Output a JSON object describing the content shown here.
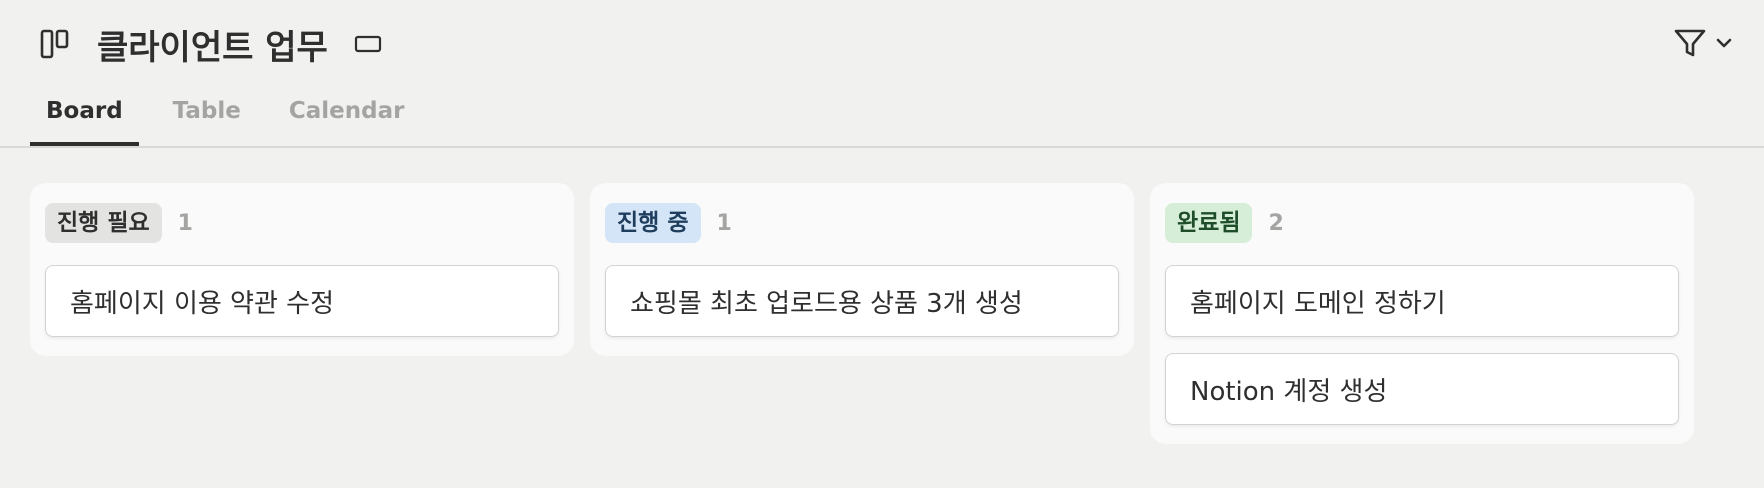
{
  "header": {
    "title": "클라이언트 업무"
  },
  "tabs": [
    {
      "label": "Board",
      "active": true
    },
    {
      "label": "Table",
      "active": false
    },
    {
      "label": "Calendar",
      "active": false
    }
  ],
  "board": {
    "columns": [
      {
        "label": "진행 필요",
        "count": "1",
        "color": "#e3e3e1",
        "cards": [
          "홈페이지 이용 약관 수정"
        ]
      },
      {
        "label": "진행 중",
        "count": "1",
        "color": "#d3e5f7",
        "cards": [
          "쇼핑몰 최초 업로드용 상품 3개 생성"
        ]
      },
      {
        "label": "완료됨",
        "count": "2",
        "color": "#d6eed8",
        "cards": [
          "홈페이지 도메인 정하기",
          "Notion 계정 생성"
        ]
      }
    ]
  },
  "icons": {
    "database": "board-view-icon",
    "view": "view-options-icon",
    "filter": "filter-icon",
    "chevron": "chevron-down-icon"
  }
}
